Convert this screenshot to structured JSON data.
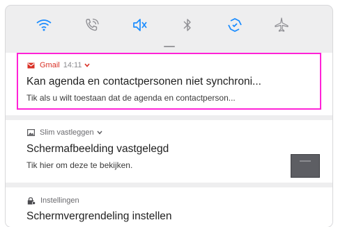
{
  "quick_settings": {
    "tiles": [
      {
        "name": "wifi",
        "icon": "wifi-icon",
        "active": true
      },
      {
        "name": "wifi-calling",
        "icon": "wifi-calling-icon",
        "active": false
      },
      {
        "name": "mute",
        "icon": "mute-icon",
        "active": true
      },
      {
        "name": "bluetooth",
        "icon": "bluetooth-icon",
        "active": false
      },
      {
        "name": "auto-sync",
        "icon": "sync-icon",
        "active": true
      },
      {
        "name": "airplane-mode",
        "icon": "airplane-icon",
        "active": false
      }
    ],
    "active_color": "#1a8cff",
    "inactive_color": "#8e8e93"
  },
  "notifications": [
    {
      "app": "Gmail",
      "time": "14:11",
      "app_icon": "gmail-icon",
      "accent_color": "#d93025",
      "title": "Kan agenda en contactpersonen niet synchroni...",
      "body": "Tik als u wilt toestaan dat de agenda en contactperson..."
    },
    {
      "app": "Slim vastleggen",
      "app_icon": "screenshot-icon",
      "title": "Schermafbeelding vastgelegd",
      "body": "Tik hier om deze te bekijken.",
      "thumbnail": "screenshot-thumbnail"
    },
    {
      "app": "Instellingen",
      "app_icon": "lock-settings-icon",
      "title": "Schermvergrendeling instellen"
    }
  ],
  "highlight_color": "#ff22d7"
}
